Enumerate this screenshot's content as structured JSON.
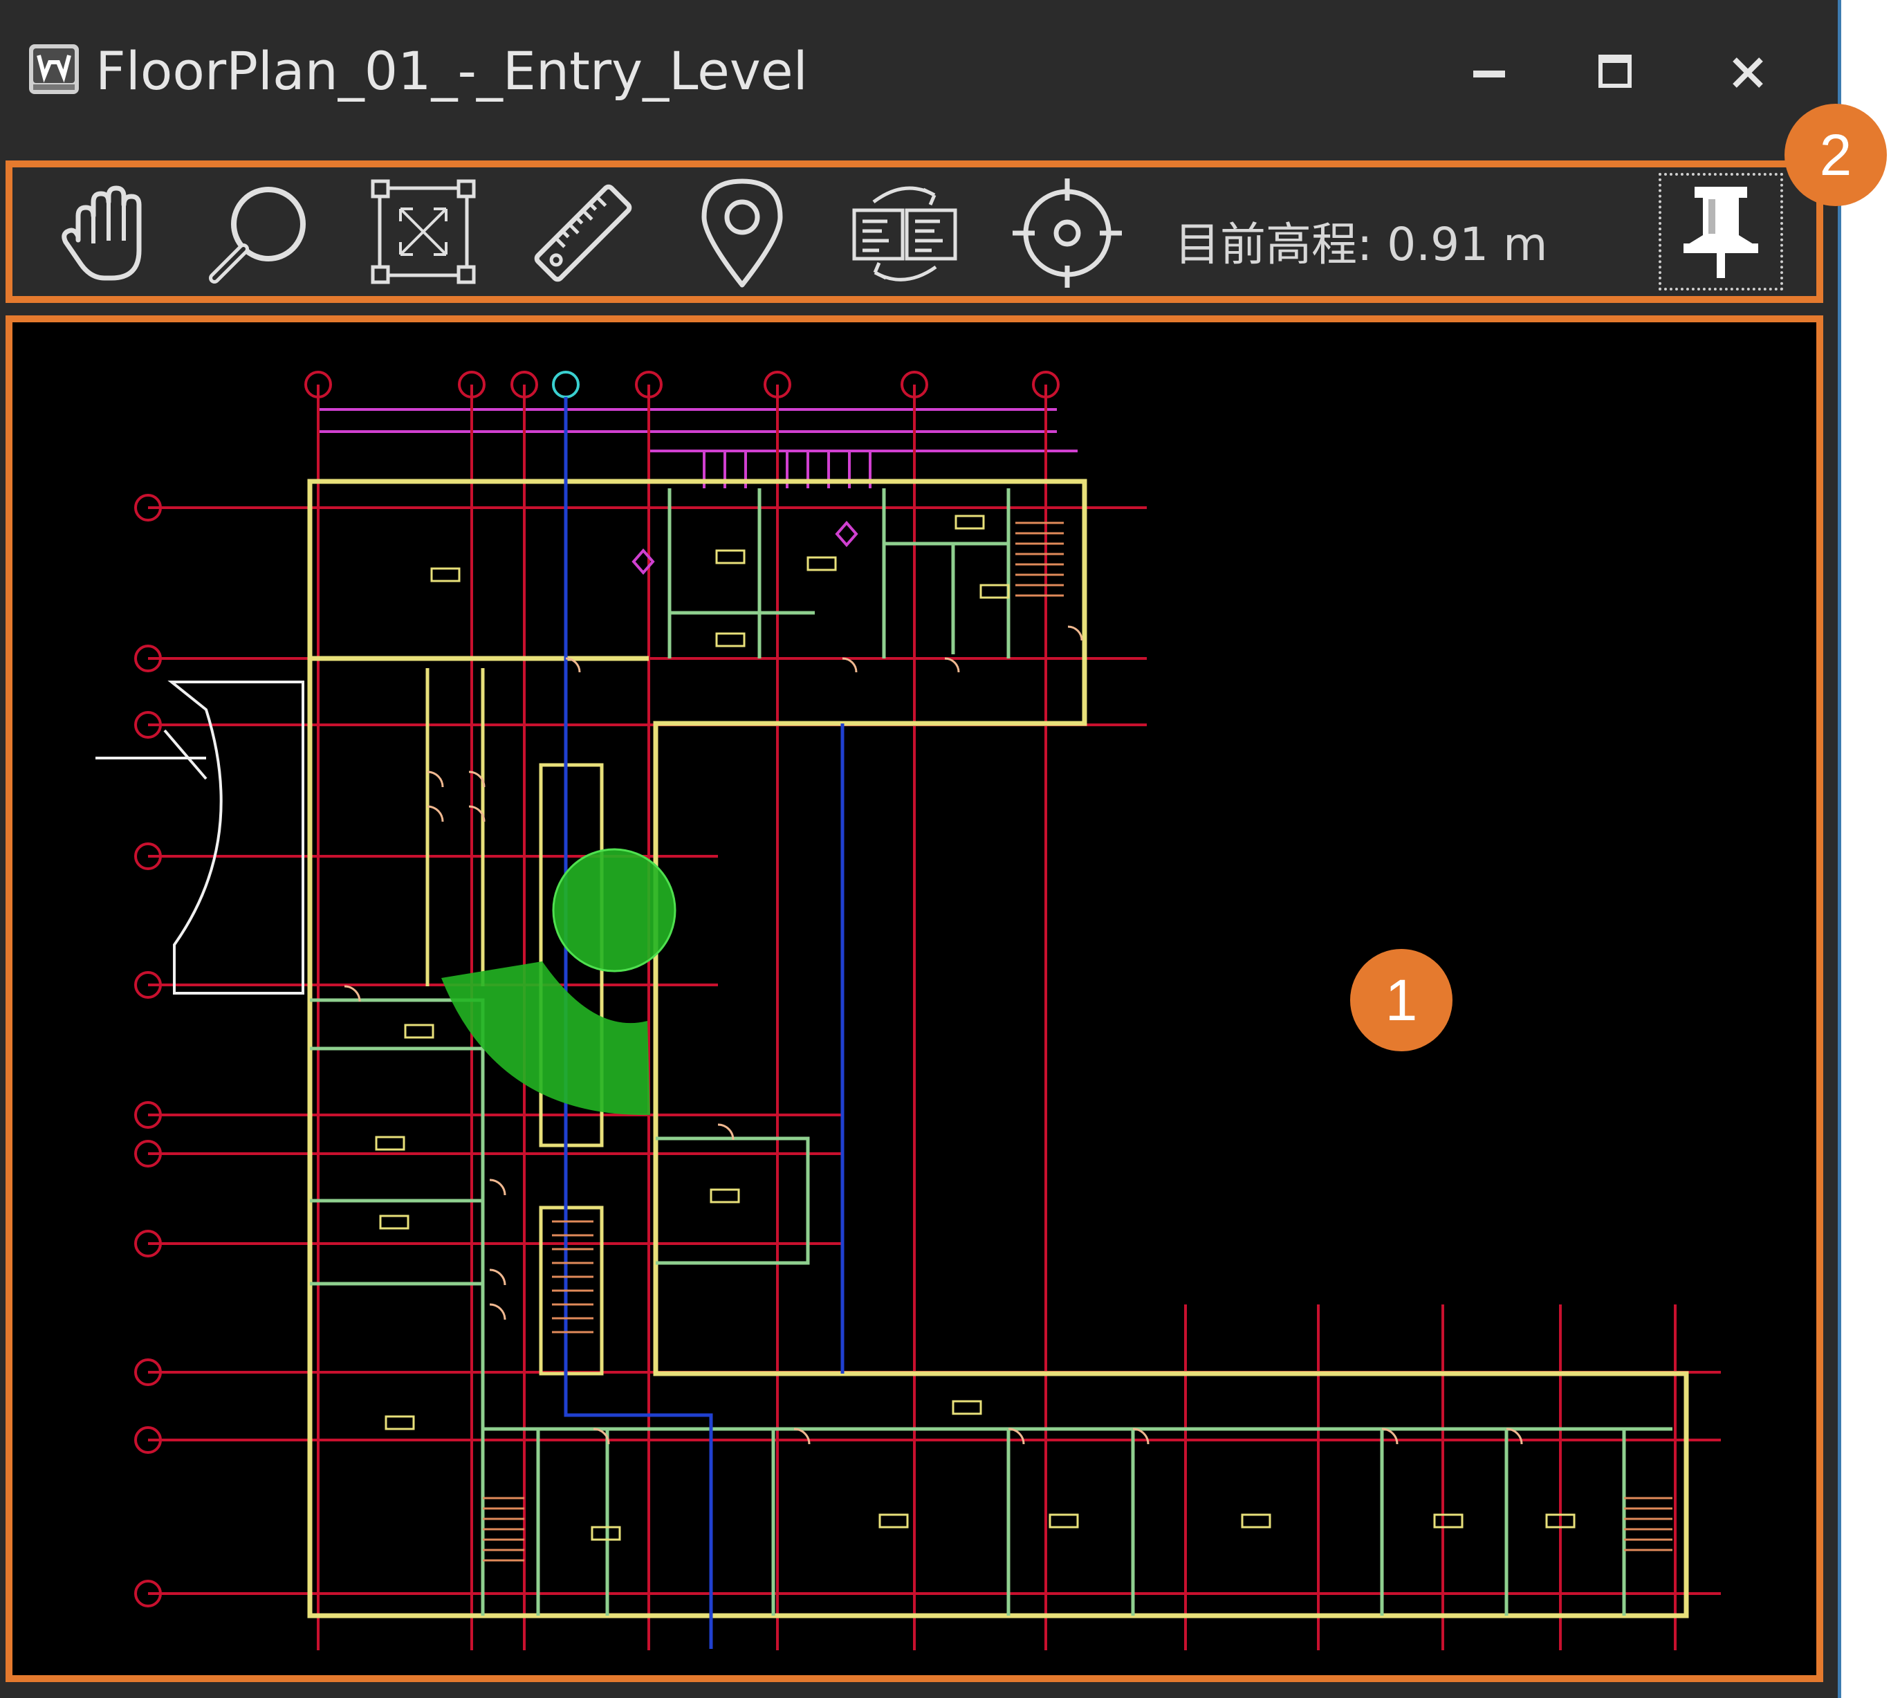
{
  "window": {
    "title": "FloorPlan_01_-_Entry_Level",
    "minimize_icon": "minimize-icon",
    "maximize_icon": "maximize-icon",
    "close_icon": "close-icon"
  },
  "toolbar": {
    "tools": [
      {
        "name": "pan-tool",
        "icon": "hand-icon"
      },
      {
        "name": "zoom-tool",
        "icon": "magnifier-icon"
      },
      {
        "name": "fit-extents-tool",
        "icon": "fit-frame-icon"
      },
      {
        "name": "measure-tool",
        "icon": "ruler-icon"
      },
      {
        "name": "location-tool",
        "icon": "map-pin-icon"
      },
      {
        "name": "sync-views-tool",
        "icon": "sync-views-icon"
      },
      {
        "name": "locate-tool",
        "icon": "crosshair-icon"
      }
    ],
    "elevation_text": "目前高程: 0.91 m",
    "pin_icon": "pushpin-icon"
  },
  "callouts": {
    "viewport": "1",
    "toolbar": "2"
  },
  "colors": {
    "highlight": "#e57a2e",
    "grid_lines": "#c8102e",
    "walls": "#e8e07a",
    "interior_walls": "#8fd08f",
    "view_cone": "#2ecc2e",
    "section_line": "#2040d0",
    "dimension_lines": "#d040d0"
  }
}
